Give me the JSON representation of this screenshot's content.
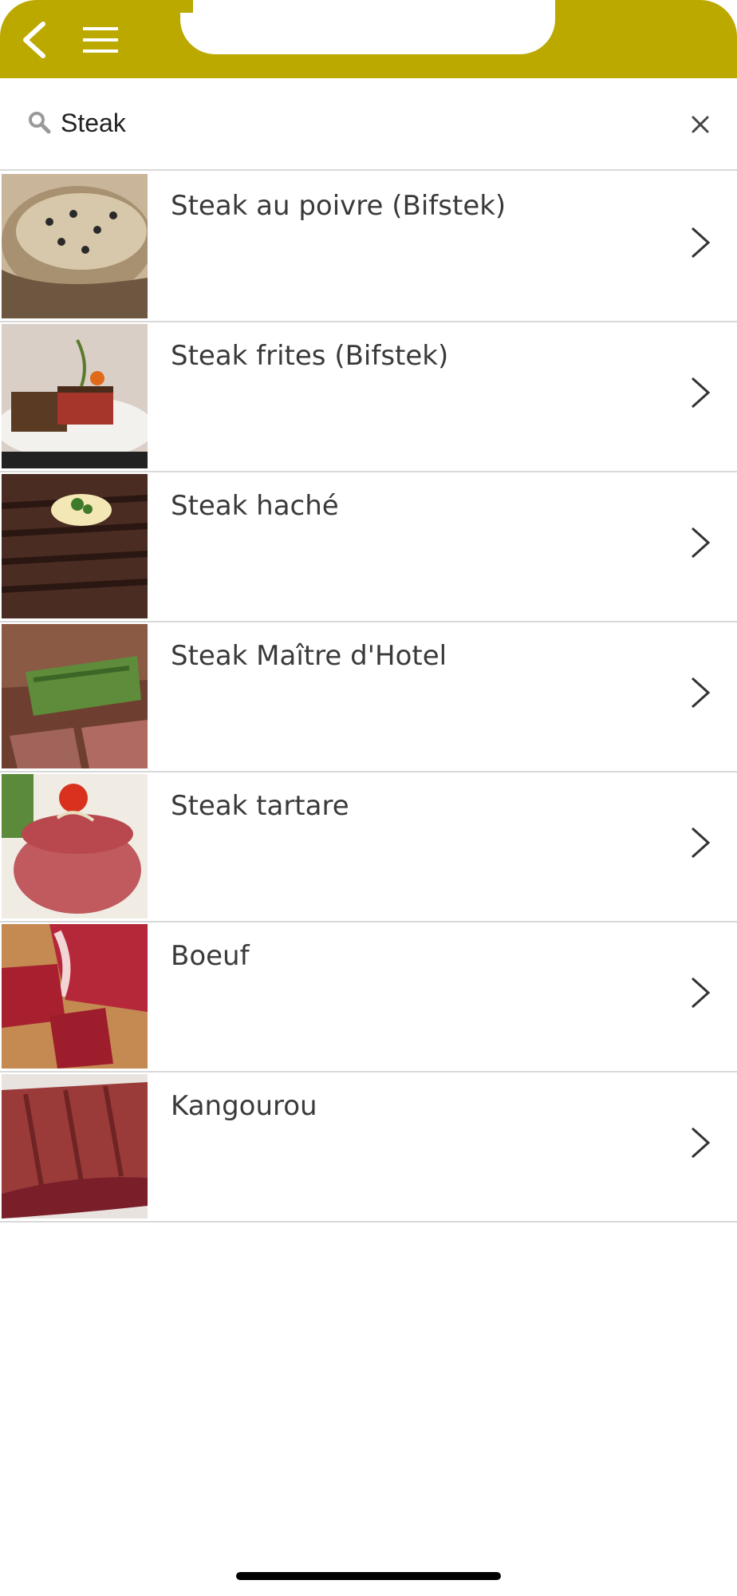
{
  "colors": {
    "header": "#bca900",
    "divider": "#d9d9d9",
    "text": "#3a3a3a"
  },
  "header": {
    "back_icon": "chevron-left-icon",
    "menu_icon": "hamburger-menu-icon"
  },
  "search": {
    "value": "Steak",
    "icon": "search-icon",
    "clear_icon": "close-icon"
  },
  "results": [
    {
      "label": "Steak au poivre (Bifstek)",
      "image": "steak-au-poivre-photo"
    },
    {
      "label": "Steak frites (Bifstek)",
      "image": "steak-frites-photo"
    },
    {
      "label": "Steak haché",
      "image": "steak-hache-photo"
    },
    {
      "label": "Steak Maître d'Hotel",
      "image": "steak-maitre-d-hotel-photo"
    },
    {
      "label": "Steak tartare",
      "image": "steak-tartare-photo"
    },
    {
      "label": "Boeuf",
      "image": "boeuf-photo"
    },
    {
      "label": "Kangourou",
      "image": "kangourou-photo"
    }
  ]
}
